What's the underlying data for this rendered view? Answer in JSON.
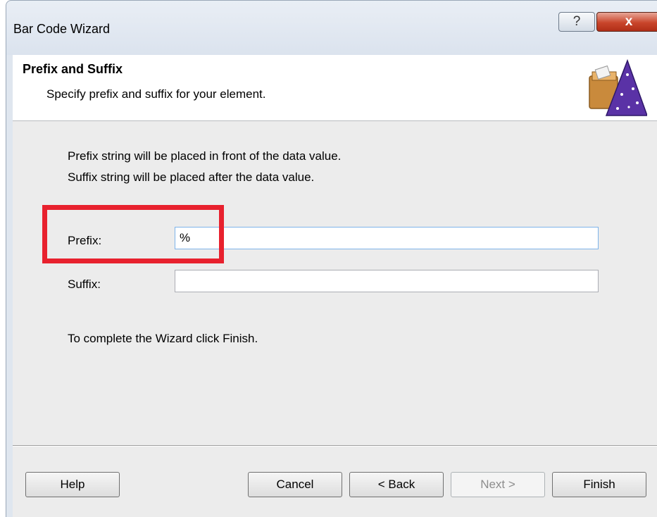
{
  "window": {
    "title": "Bar Code Wizard",
    "help_glyph": "?",
    "close_glyph": "x"
  },
  "header": {
    "title": "Prefix and Suffix",
    "subtitle": "Specify prefix and suffix for your element.",
    "icon": "wizard-hat-icon"
  },
  "content": {
    "info_line1": "Prefix string will be placed in front of the data value.",
    "info_line2": "Suffix string will be placed after the data value.",
    "prefix_label": "Prefix:",
    "prefix_value": "%",
    "suffix_label": "Suffix:",
    "suffix_value": "",
    "complete_text": "To complete the Wizard click Finish."
  },
  "buttons": {
    "help": "Help",
    "cancel": "Cancel",
    "back": "< Back",
    "next": "Next >",
    "finish": "Finish"
  },
  "colors": {
    "highlight": "#e8212e",
    "close_button": "#c9452b"
  }
}
